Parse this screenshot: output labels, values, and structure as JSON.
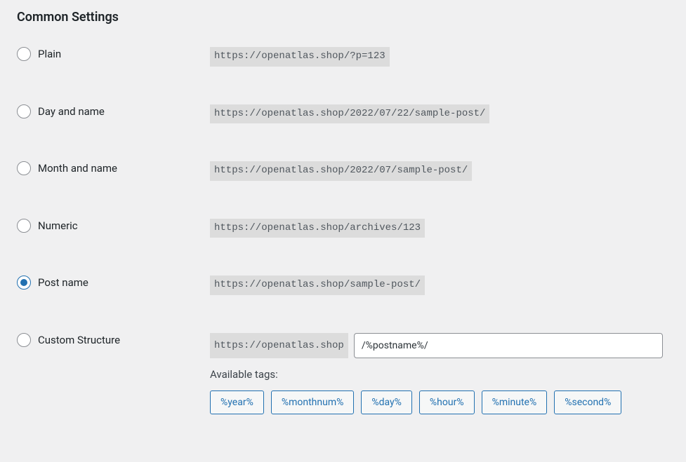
{
  "heading": "Common Settings",
  "options": [
    {
      "label": "Plain",
      "sample": "https://openatlas.shop/?p=123",
      "checked": false
    },
    {
      "label": "Day and name",
      "sample": "https://openatlas.shop/2022/07/22/sample-post/",
      "checked": false
    },
    {
      "label": "Month and name",
      "sample": "https://openatlas.shop/2022/07/sample-post/",
      "checked": false
    },
    {
      "label": "Numeric",
      "sample": "https://openatlas.shop/archives/123",
      "checked": false
    },
    {
      "label": "Post name",
      "sample": "https://openatlas.shop/sample-post/",
      "checked": true
    }
  ],
  "custom": {
    "label": "Custom Structure",
    "checked": false,
    "prefix": "https://openatlas.shop",
    "value": "/%postname%/",
    "available_label": "Available tags:",
    "tags": [
      "%year%",
      "%monthnum%",
      "%day%",
      "%hour%",
      "%minute%",
      "%second%"
    ]
  }
}
